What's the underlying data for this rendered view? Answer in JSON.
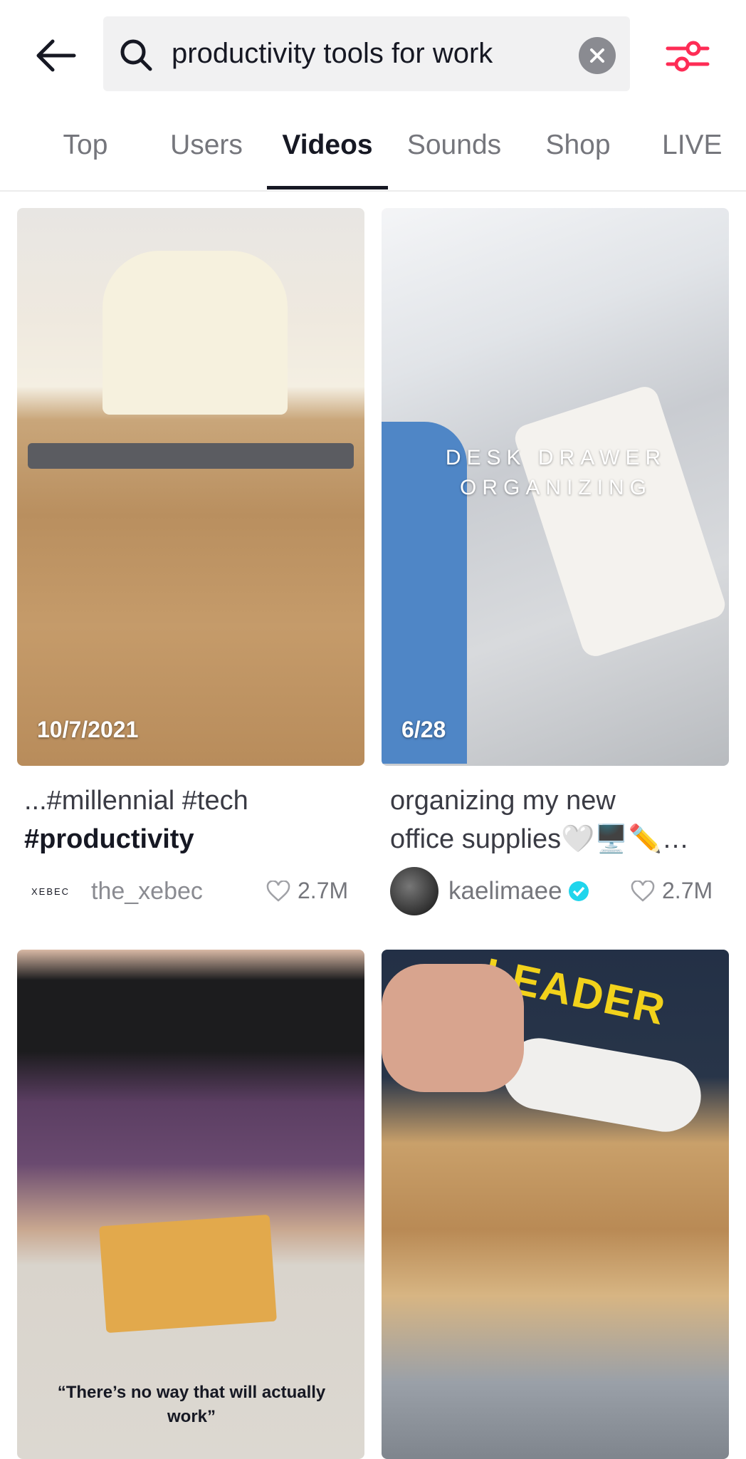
{
  "search": {
    "query": "productivity tools for work"
  },
  "tabs": [
    {
      "label": "Top"
    },
    {
      "label": "Users"
    },
    {
      "label": "Videos"
    },
    {
      "label": "Sounds"
    },
    {
      "label": "Shop"
    },
    {
      "label": "LIVE"
    }
  ],
  "active_tab": "Videos",
  "accent": "#fe2c55",
  "videos": [
    {
      "date": "10/7/2021",
      "caption_prefix": "...#millennial #tech",
      "caption_bold": "#productivity",
      "avatar_text": "XEBEC",
      "author": "the_xebec",
      "likes": "2.7M"
    },
    {
      "date": "6/28",
      "overlay": "DESK DRAWER ORGANIZING",
      "caption_line1": "organizing my new",
      "caption_line2": "office supplies🤍🖥️✏️…",
      "author": "kaelimaee",
      "verified": true,
      "likes": "2.7M"
    },
    {
      "overlay": "“There’s no way that will actually work”"
    },
    {
      "overlay": "LEADER"
    }
  ]
}
